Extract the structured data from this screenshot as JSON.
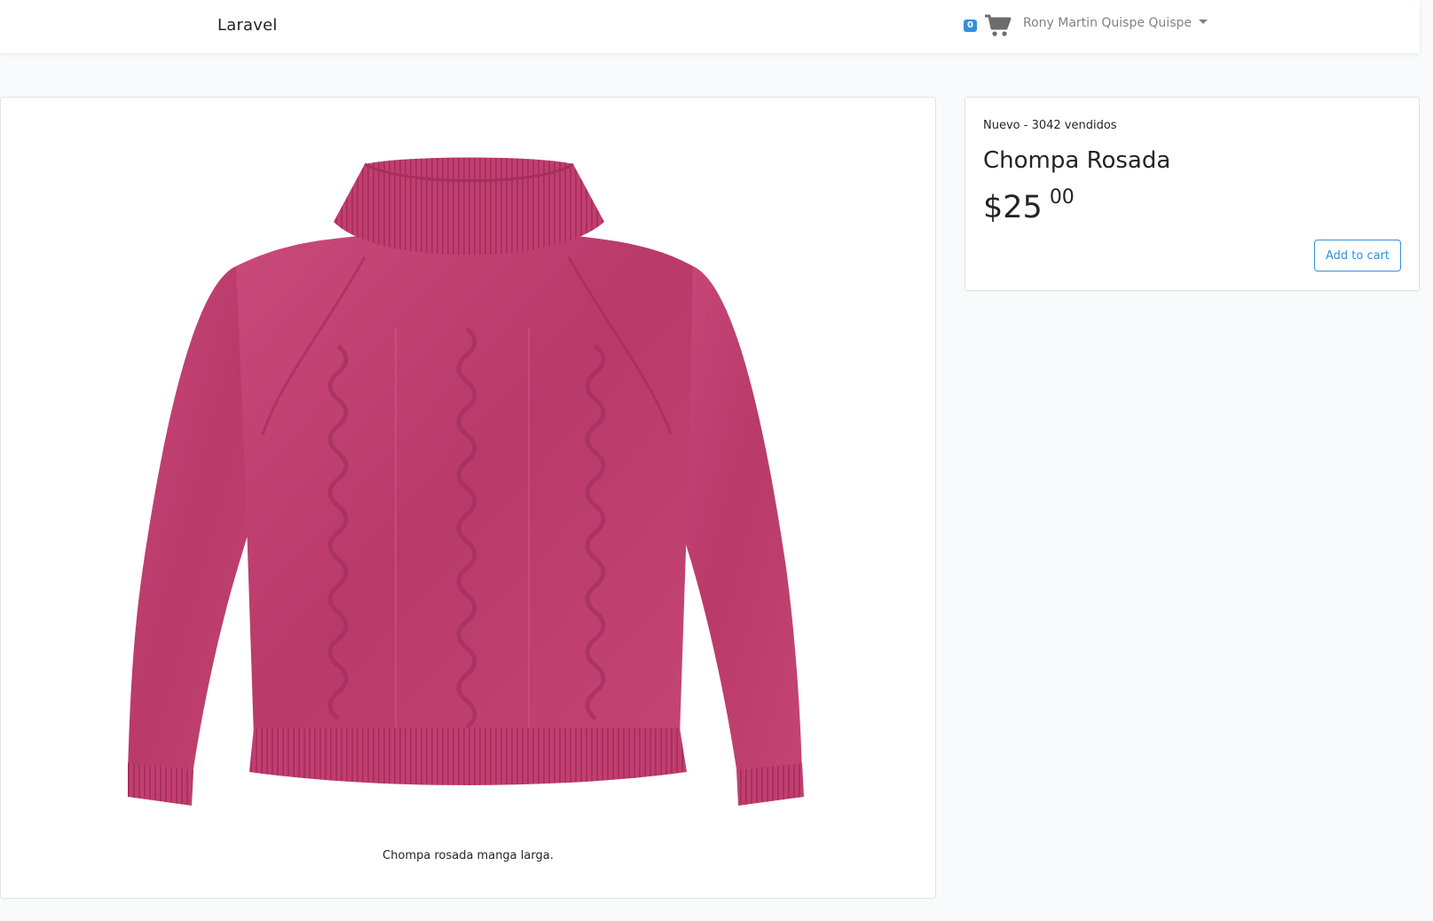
{
  "navbar": {
    "brand": "Laravel",
    "cart_count": "0",
    "user_name": "Rony Martin Quispe Quispe"
  },
  "product": {
    "meta": "Nuevo - 3042 vendidos",
    "title": "Chompa Rosada",
    "price_main": "$25",
    "price_cents": "00",
    "add_button": "Add to cart",
    "caption": "Chompa rosada manga larga."
  },
  "colors": {
    "accent": "#3490dc",
    "sweater": "#c13f70",
    "background": "#f8fafc"
  },
  "icons": {
    "cart": "shopping-cart-icon",
    "dropdown": "caret-down-icon"
  }
}
